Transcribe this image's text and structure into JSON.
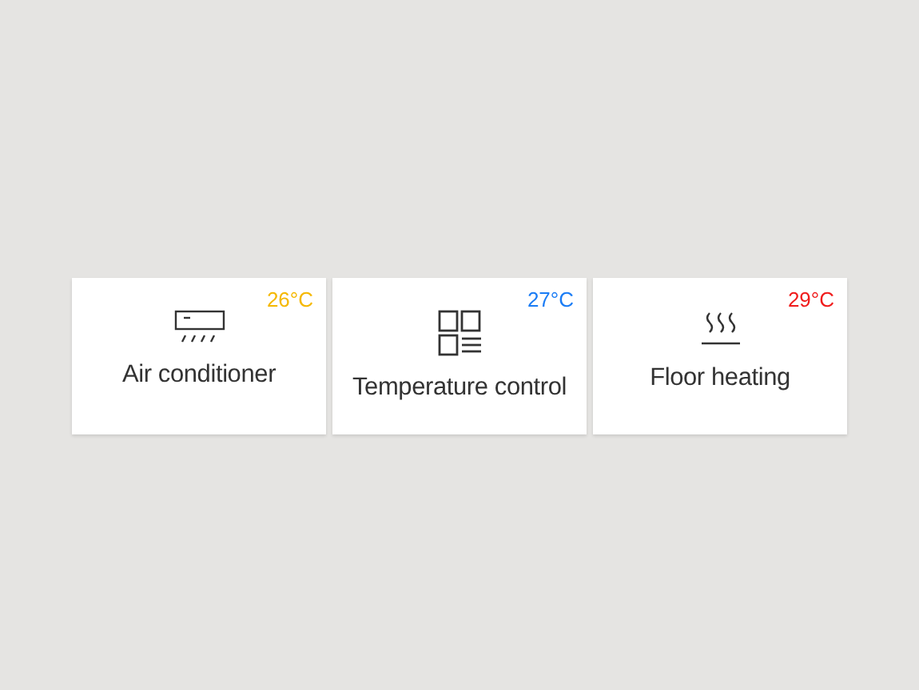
{
  "devices": [
    {
      "kind": "ac",
      "name": "Air conditioner",
      "temperature": "26°C",
      "color": "#f5b800"
    },
    {
      "kind": "grid",
      "name": "Temperature control",
      "temperature": "27°C",
      "color": "#1a7cf5"
    },
    {
      "kind": "heat",
      "name": "Floor heating",
      "temperature": "29°C",
      "color": "#f01c1c"
    }
  ]
}
